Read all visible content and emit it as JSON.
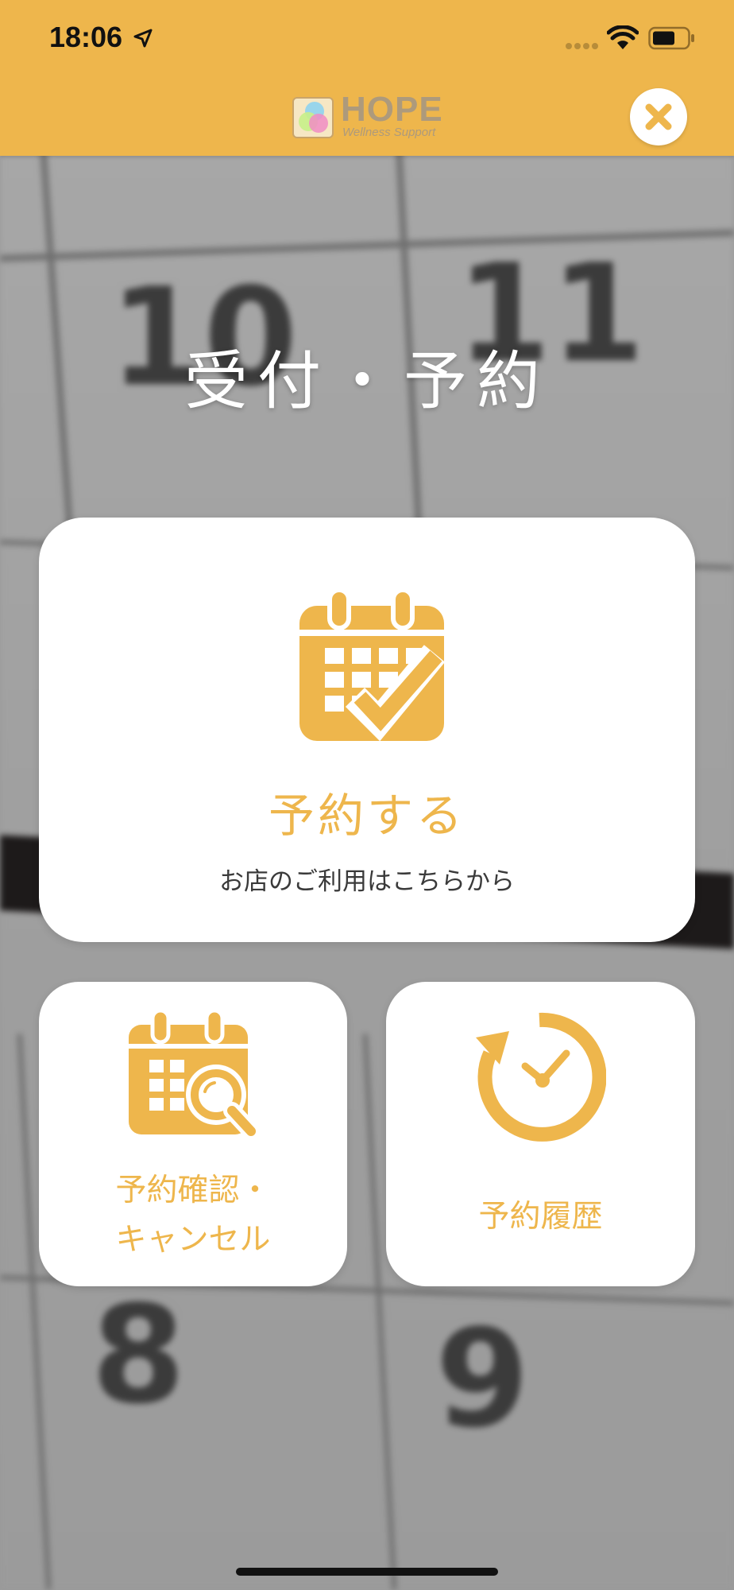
{
  "status_bar": {
    "time": "18:06"
  },
  "header": {
    "logo_text": "HOPE",
    "logo_subtext": "Wellness Support",
    "close_icon": "close-icon"
  },
  "background": {
    "numbers": [
      "10",
      "11",
      "8",
      "9"
    ]
  },
  "title": "受付・予約",
  "cards": {
    "reserve": {
      "label": "予約する",
      "sub": "お店のご利用はこちらから",
      "icon": "calendar-check-icon"
    },
    "confirm": {
      "label_line1": "予約確認・",
      "label_line2": "キャンセル",
      "icon": "calendar-search-icon"
    },
    "history": {
      "label": "予約履歴",
      "icon": "history-clock-icon"
    }
  },
  "colors": {
    "accent": "#eeb64c",
    "card_bg": "#ffffff",
    "title_text": "#ffffff"
  }
}
